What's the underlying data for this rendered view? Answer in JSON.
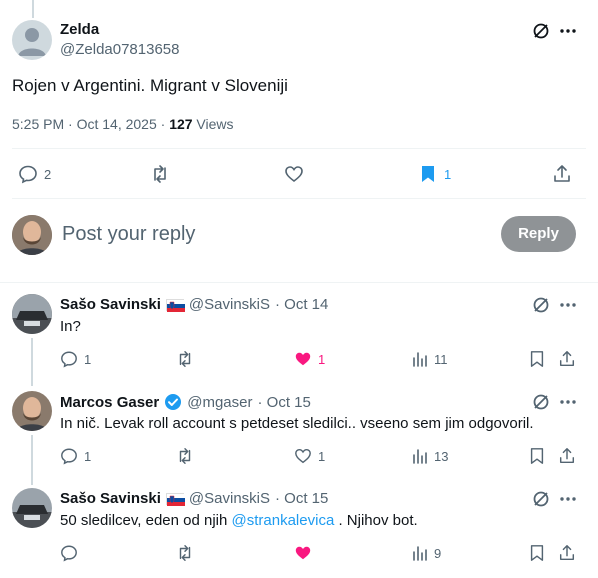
{
  "main_tweet": {
    "name": "Zelda",
    "handle": "@Zelda07813658",
    "text": "Rojen v Argentini. Migrant v Sloveniji",
    "timestamp": "5:25 PM · Oct 14, 2025 · ",
    "views_count": "127",
    "views_label": " Views",
    "replies": "2",
    "bookmarks": "1"
  },
  "compose": {
    "placeholder": "Post your reply",
    "button": "Reply"
  },
  "replies": [
    {
      "name": "Sašo Savinski",
      "flag": "slovenia-flag",
      "handle": "@SavinskiS",
      "date": "· Oct 14",
      "text": "In?",
      "replies": "1",
      "likes": "1",
      "liked": true,
      "views": "11"
    },
    {
      "name": "Marcos Gaser",
      "verified": true,
      "handle": "@mgaser",
      "date": "· Oct 15",
      "text": "In nič. Levak roll account s petdeset sledilci.. vseeno sem jim odgovoril.",
      "replies": "1",
      "likes": "1",
      "liked": false,
      "views": "13"
    },
    {
      "name": "Sašo Savinski",
      "flag": "slovenia-flag",
      "handle": "@SavinskiS",
      "date": "· Oct 15",
      "text_before": "50 sledilcev, eden od njih ",
      "mention": "@strankalevica",
      "text_after": " . Njihov bot.",
      "liked": true,
      "views": "9"
    }
  ],
  "colors": {
    "accent": "#1d9bf0",
    "like": "#f91880",
    "muted": "#536471",
    "reply_button_bg": "#8f9396"
  }
}
